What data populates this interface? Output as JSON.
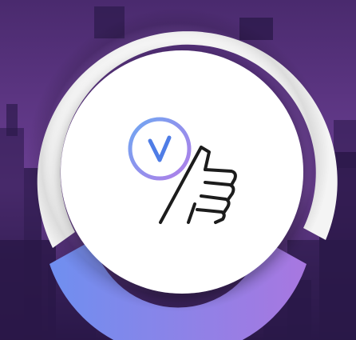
{
  "colors": {
    "sky_top": "#4a2a6e",
    "sky_mid": "#6b3f93",
    "city_dark": "#2a1848",
    "ring_outer": "#f4f4f4",
    "ring_shadow": "#cfcfcf",
    "disc_fill": "#ffffff",
    "gradient_start": "#6f8ff0",
    "gradient_end": "#a877e0",
    "check_circle_start": "#6fa7f2",
    "check_circle_end": "#b07ee8",
    "check_mark": "#4f7de6",
    "thumb_stroke": "#1c1c1c"
  },
  "icons": {
    "check": "verified-check-icon",
    "thumb": "thumbs-up-icon"
  }
}
